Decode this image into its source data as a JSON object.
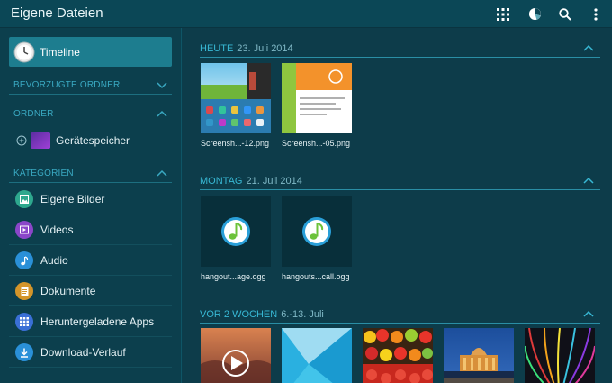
{
  "appbar": {
    "title": "Eigene Dateien",
    "actions": [
      {
        "name": "grid-view-icon"
      },
      {
        "name": "storage-usage-icon"
      },
      {
        "name": "search-icon"
      },
      {
        "name": "more-options-icon"
      }
    ]
  },
  "sidebar": {
    "timeline_label": "Timeline",
    "favorites_header": "BEVORZUGTE ORDNER",
    "folders_header": "ORDNER",
    "folders": [
      {
        "label": "Gerätespeicher"
      }
    ],
    "categories_header": "KATEGORIEN",
    "categories": [
      {
        "label": "Eigene Bilder",
        "icon": "images-icon",
        "color": "#2ea88e"
      },
      {
        "label": "Videos",
        "icon": "video-icon",
        "color": "#8b46c9"
      },
      {
        "label": "Audio",
        "icon": "music-note-icon",
        "color": "#2a90d8"
      },
      {
        "label": "Dokumente",
        "icon": "document-icon",
        "color": "#d4952a"
      },
      {
        "label": "Heruntergeladene Apps",
        "icon": "apps-icon",
        "color": "#3a6fd6"
      },
      {
        "label": "Download-Verlauf",
        "icon": "download-icon",
        "color": "#2a90d8"
      }
    ]
  },
  "groups": [
    {
      "when": "HEUTE",
      "date": "23. Juli 2014",
      "items": [
        {
          "name": "Screensh...-12.png",
          "kind": "screenshot-home"
        },
        {
          "name": "Screensh...-05.png",
          "kind": "screenshot-email"
        }
      ]
    },
    {
      "when": "MONTAG",
      "date": "21. Juli 2014",
      "items": [
        {
          "name": "hangout...age.ogg",
          "kind": "audio"
        },
        {
          "name": "hangouts...call.ogg",
          "kind": "audio"
        }
      ]
    },
    {
      "when": "VOR 2 WOCHEN",
      "date": "6.-13. Juli",
      "items": [
        {
          "kind": "video"
        },
        {
          "kind": "image-abstract"
        },
        {
          "kind": "image-fruit"
        },
        {
          "kind": "image-palace"
        },
        {
          "kind": "image-lights"
        }
      ]
    }
  ],
  "colors": {
    "accent": "#38b8d4",
    "selected": "#1d7d8f",
    "background": "#0b3d4b"
  }
}
